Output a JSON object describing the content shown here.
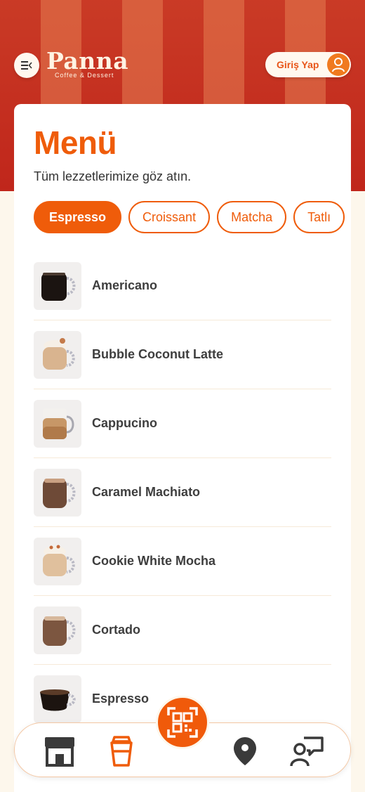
{
  "header": {
    "brand_name": "Panna",
    "brand_tagline": "Coffee & Dessert",
    "login_label": "Giriş Yap"
  },
  "page": {
    "title": "Menü",
    "subtitle": "Tüm lezzetlerimize göz atın."
  },
  "categories": [
    {
      "label": "Espresso",
      "active": true
    },
    {
      "label": "Croissant",
      "active": false
    },
    {
      "label": "Matcha",
      "active": false
    },
    {
      "label": "Tatlı",
      "active": false
    }
  ],
  "menu_items": [
    {
      "name": "Americano",
      "icon": "black-coffee-cup-icon"
    },
    {
      "name": "Bubble Coconut Latte",
      "icon": "latte-cup-icon"
    },
    {
      "name": "Cappucino",
      "icon": "cappuccino-glass-icon"
    },
    {
      "name": "Caramel Machiato",
      "icon": "caramel-cup-icon"
    },
    {
      "name": "Cookie White Mocha",
      "icon": "mocha-cup-icon"
    },
    {
      "name": "Cortado",
      "icon": "cortado-cup-icon"
    },
    {
      "name": "Espresso",
      "icon": "espresso-cup-icon"
    }
  ],
  "bottom_nav": {
    "items": [
      "store-icon",
      "drink-cup-icon",
      "qr-code-icon",
      "location-pin-icon",
      "support-chat-icon"
    ]
  },
  "colors": {
    "accent": "#ef5c0a",
    "hero_red": "#c0261b",
    "hero_stripe": "#d4563a",
    "background": "#fdf7ec"
  }
}
